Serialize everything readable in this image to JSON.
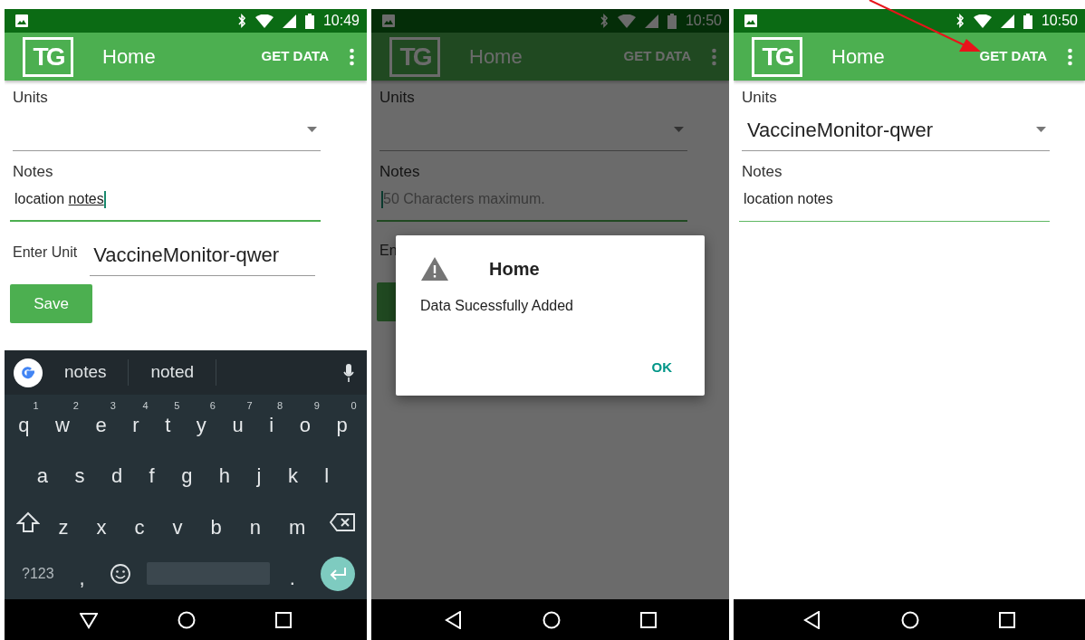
{
  "screens": [
    {
      "status_bar": {
        "time": "10:49"
      },
      "app_bar": {
        "logo": "TG",
        "title": "Home",
        "action": "GET DATA"
      },
      "form": {
        "units": {
          "label": "Units"
        },
        "notes": {
          "label": "Notes",
          "value": "location ",
          "composing_text": "notes",
          "focused": true
        },
        "enter_unit": {
          "label": "Enter Unit",
          "value": "VaccineMonitor-qwer"
        },
        "save_button": "Save"
      },
      "keyboard": {
        "suggestions": [
          "notes",
          "noted"
        ],
        "rows": [
          {
            "keys": [
              {
                "key": "q",
                "hint": "1"
              },
              {
                "key": "w",
                "hint": "2"
              },
              {
                "key": "e",
                "hint": "3"
              },
              {
                "key": "r",
                "hint": "4"
              },
              {
                "key": "t",
                "hint": "5"
              },
              {
                "key": "y",
                "hint": "6"
              },
              {
                "key": "u",
                "hint": "7"
              },
              {
                "key": "i",
                "hint": "8"
              },
              {
                "key": "o",
                "hint": "9"
              },
              {
                "key": "p",
                "hint": "0"
              }
            ]
          },
          {
            "keys": [
              {
                "key": "a"
              },
              {
                "key": "s"
              },
              {
                "key": "d"
              },
              {
                "key": "f"
              },
              {
                "key": "g"
              },
              {
                "key": "h"
              },
              {
                "key": "j"
              },
              {
                "key": "k"
              },
              {
                "key": "l"
              }
            ]
          },
          {
            "keys": [
              {
                "kind": "shift"
              },
              {
                "key": "z"
              },
              {
                "key": "x"
              },
              {
                "key": "c"
              },
              {
                "key": "v"
              },
              {
                "key": "b"
              },
              {
                "key": "n"
              },
              {
                "key": "m"
              },
              {
                "kind": "backspace"
              }
            ]
          },
          {
            "keys": [
              {
                "kind": "symbols",
                "key": "?123"
              },
              {
                "key": ","
              },
              {
                "kind": "emoji"
              },
              {
                "kind": "space"
              },
              {
                "key": "."
              },
              {
                "kind": "enter"
              }
            ]
          }
        ]
      }
    },
    {
      "status_bar": {
        "time": "10:50"
      },
      "app_bar": {
        "logo": "TG",
        "title": "Home",
        "action": "GET DATA"
      },
      "form": {
        "units": {
          "label": "Units"
        },
        "notes": {
          "label": "Notes",
          "placeholder": "50 Characters maximum.",
          "focused": true
        },
        "enter_unit": {
          "label": "En"
        }
      },
      "dialog": {
        "title": "Home",
        "message": "Data Sucessfully Added",
        "button": "OK"
      }
    },
    {
      "status_bar": {
        "time": "10:50"
      },
      "app_bar": {
        "logo": "TG",
        "title": "Home",
        "action": "GET DATA"
      },
      "form": {
        "units": {
          "label": "Units",
          "value": "VaccineMonitor-qwer"
        },
        "notes": {
          "label": "Notes",
          "value": "location notes",
          "focused": false
        }
      }
    }
  ]
}
